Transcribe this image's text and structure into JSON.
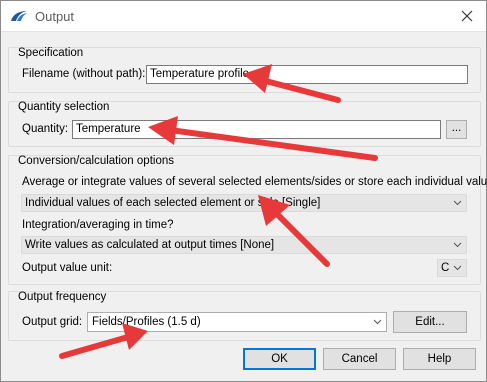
{
  "window": {
    "title": "Output",
    "icons": {
      "app": "app-logo-icon",
      "close": "close-icon"
    }
  },
  "specification": {
    "group_title": "Specification",
    "filename_label": "Filename (without path):",
    "filename_value": "Temperature profile"
  },
  "quantity": {
    "group_title": "Quantity selection",
    "label": "Quantity:",
    "value": "Temperature",
    "browse_label": "..."
  },
  "conversion": {
    "group_title": "Conversion/calculation options",
    "aggregate_question": "Average or integrate values of several selected elements/sides or store each individual value?",
    "aggregate_selected": "Individual values of each selected element or side [Single]",
    "time_question": "Integration/averaging in time?",
    "time_selected": "Write values as calculated at output times [None]",
    "unit_label": "Output value unit:",
    "unit_selected": "C"
  },
  "frequency": {
    "group_title": "Output frequency",
    "grid_label": "Output grid:",
    "grid_selected": "Fields/Profiles (1.5 d)",
    "edit_label": "Edit..."
  },
  "buttons": {
    "ok": "OK",
    "cancel": "Cancel",
    "help": "Help"
  },
  "colors": {
    "annotation_arrow": "#e8393a",
    "default_button_border": "#0078d7"
  }
}
